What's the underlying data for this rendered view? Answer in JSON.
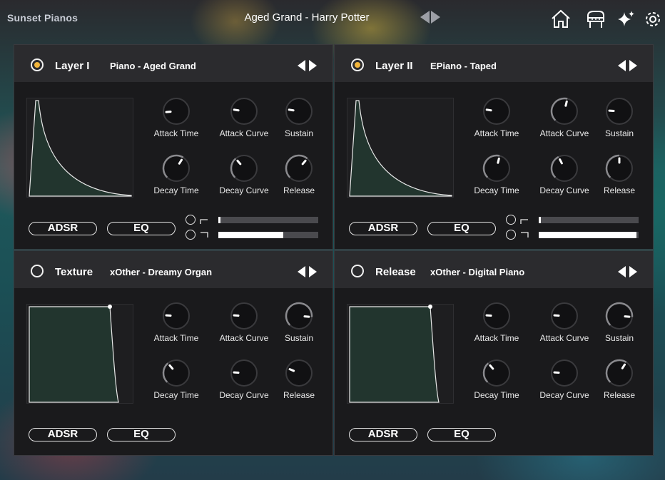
{
  "app": {
    "brand": "Sunset Pianos",
    "preset_name": "Aged Grand - Harry Potter",
    "icons": [
      "home-icon",
      "piano-icon",
      "sparkle-icon",
      "gear-icon"
    ]
  },
  "colors": {
    "accent": "#f0b43c",
    "panel": "#1a1a1c",
    "header": "#2b2b2e",
    "env_fill": "#22352e"
  },
  "knob_labels": [
    "Attack Time",
    "Attack Curve",
    "Sustain",
    "Decay Time",
    "Decay Curve",
    "Release"
  ],
  "buttons": {
    "adsr": "ADSR",
    "eq": "EQ"
  },
  "layers": [
    {
      "name": "Layer I",
      "patch": "Piano - Aged Grand",
      "selected": true,
      "envelope_shape": "decay",
      "knob_values": [
        0.15,
        0.2,
        0.2,
        0.62,
        0.35,
        0.65
      ],
      "eq": {
        "low": 0.02,
        "high": 0.65
      }
    },
    {
      "name": "Layer II",
      "patch": "EPiano - Taped",
      "selected": true,
      "envelope_shape": "decay",
      "knob_values": [
        0.2,
        0.55,
        0.18,
        0.55,
        0.4,
        0.5
      ],
      "eq": {
        "low": 0.02,
        "high": 0.98
      }
    },
    {
      "name": "Texture",
      "patch": "xOther - Dreamy Organ",
      "selected": false,
      "envelope_shape": "sustain",
      "knob_values": [
        0.18,
        0.18,
        0.85,
        0.35,
        0.18,
        0.25
      ],
      "eq": null
    },
    {
      "name": "Release",
      "patch": "xOther - Digital Piano",
      "selected": false,
      "envelope_shape": "sustain",
      "knob_values": [
        0.18,
        0.18,
        0.85,
        0.35,
        0.18,
        0.62
      ],
      "eq": null
    }
  ]
}
